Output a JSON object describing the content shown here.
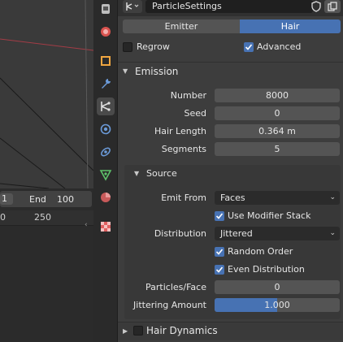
{
  "timeline": {
    "frame_left": "1",
    "end_label": "End",
    "end_value": "100",
    "ruler_0": "0",
    "ruler_250": "250"
  },
  "header": {
    "datablock_name": "ParticleSettings"
  },
  "tabs": {
    "emitter_label": "Emitter",
    "hair_label": "Hair",
    "active": "Hair"
  },
  "options": {
    "regrow_label": "Regrow",
    "regrow_checked": false,
    "advanced_label": "Advanced",
    "advanced_checked": true
  },
  "emission": {
    "title": "Emission",
    "number_label": "Number",
    "number_value": "8000",
    "seed_label": "Seed",
    "seed_value": "0",
    "hair_length_label": "Hair Length",
    "hair_length_value": "0.364 m",
    "segments_label": "Segments",
    "segments_value": "5"
  },
  "source": {
    "title": "Source",
    "emit_from_label": "Emit From",
    "emit_from_value": "Faces",
    "use_modifier_stack_label": "Use Modifier Stack",
    "distribution_label": "Distribution",
    "distribution_value": "Jittered",
    "random_order_label": "Random Order",
    "even_distribution_label": "Even Distribution",
    "particles_face_label": "Particles/Face",
    "particles_face_value": "0",
    "jittering_amount_label": "Jittering Amount",
    "jittering_amount_value": "1.000",
    "jittering_fraction": 0.5
  },
  "hair_dynamics": {
    "title": "Hair Dynamics",
    "checked": false
  },
  "colors": {
    "accent": "#4772b3",
    "panel_bg": "#3d3d3d",
    "field_bg": "#545454",
    "dropdown_bg": "#2b2b2b"
  }
}
